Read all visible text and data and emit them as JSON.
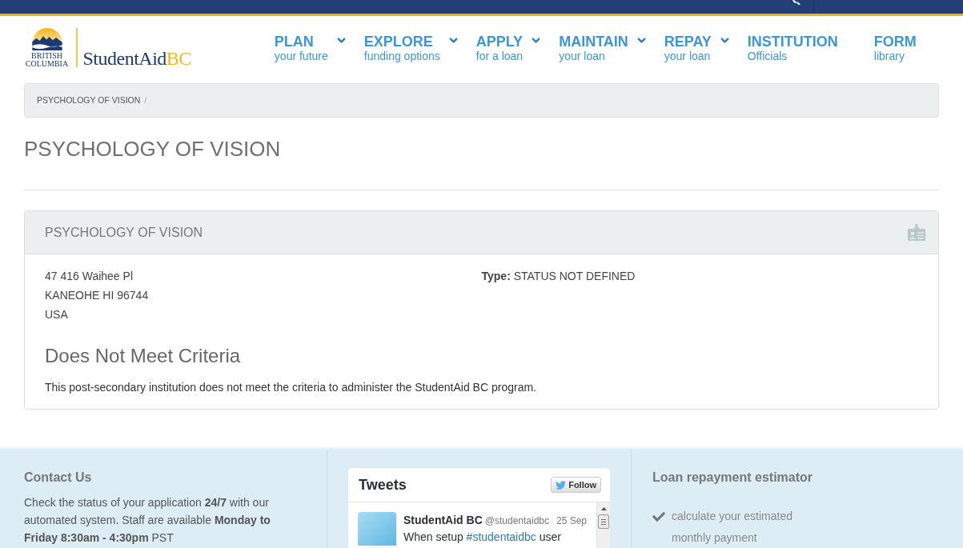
{
  "header": {
    "logo": {
      "province_lines": [
        "BRITISH",
        "COLUMBIA"
      ],
      "brand": "StudentAid",
      "brand_accent": "BC"
    },
    "nav": [
      {
        "title": "PLAN",
        "subtitle": "your future",
        "has_dropdown": true
      },
      {
        "title": "EXPLORE",
        "subtitle": "funding options",
        "has_dropdown": true
      },
      {
        "title": "APPLY",
        "subtitle": "for a loan",
        "has_dropdown": true
      },
      {
        "title": "MAINTAIN",
        "subtitle": "your loan",
        "has_dropdown": true
      },
      {
        "title": "REPAY",
        "subtitle": "your loan",
        "has_dropdown": true
      },
      {
        "title": "INSTITUTION",
        "subtitle": "Officials",
        "has_dropdown": false
      },
      {
        "title": "FORM",
        "subtitle": "library",
        "has_dropdown": false
      }
    ]
  },
  "breadcrumb": {
    "items": [
      {
        "label": "PSYCHOLOGY OF VISION"
      }
    ],
    "separator": "/"
  },
  "page_title": "PSYCHOLOGY OF VISION",
  "panel": {
    "title": "PSYCHOLOGY OF VISION",
    "address": [
      "47 416 Waihee Pl",
      "KANEOHE HI 96744",
      "USA"
    ],
    "type": {
      "label": "Type:",
      "value": "STATUS NOT DEFINED"
    },
    "status_heading": "Does Not Meet Criteria",
    "status_text": "This post-secondary institution does not meet the criteria to administer the StudentAid BC program."
  },
  "footer": {
    "contact": {
      "title": "Contact Us",
      "text": "Check the status of your application **24/7** with our automated system. Staff are available **Monday to Friday 8:30am - 4:30pm** PST"
    },
    "tweets": {
      "title": "Tweets",
      "follow_label": "Follow",
      "items": [
        {
          "name": "StudentAid BC",
          "handle": "@studentaidbc",
          "date": "25 Sep",
          "text_parts": [
            {
              "kind": "text",
              "text": "When setup"
            },
            {
              "kind": "hashtag",
              "text": "#studentaidbc"
            },
            {
              "kind": "text",
              "text": "user"
            }
          ]
        }
      ]
    },
    "loan_estimator": {
      "title": "Loan repayment estimator",
      "items": [
        "calculate your estimated monthly payment"
      ]
    }
  }
}
